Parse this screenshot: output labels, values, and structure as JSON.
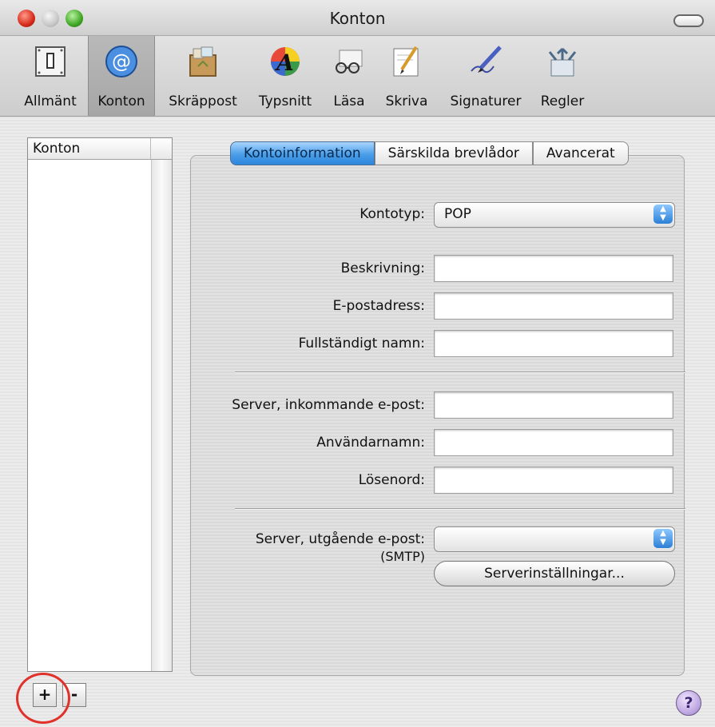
{
  "window": {
    "title": "Konton"
  },
  "toolbar": {
    "items": [
      {
        "label": "Allmänt",
        "icon": "switch-icon"
      },
      {
        "label": "Konton",
        "icon": "at-sign-icon"
      },
      {
        "label": "Skräppost",
        "icon": "junk-mail-icon"
      },
      {
        "label": "Typsnitt",
        "icon": "font-icon"
      },
      {
        "label": "Läsa",
        "icon": "glasses-icon"
      },
      {
        "label": "Skriva",
        "icon": "pencil-icon"
      },
      {
        "label": "Signaturer",
        "icon": "pen-icon"
      },
      {
        "label": "Regler",
        "icon": "rules-icon"
      }
    ]
  },
  "accounts": {
    "header": "Konton",
    "add_label": "+",
    "remove_label": "-"
  },
  "tabs": [
    "Kontoinformation",
    "Särskilda brevlådor",
    "Avancerat"
  ],
  "form": {
    "account_type_label": "Kontotyp:",
    "account_type_value": "POP",
    "description_label": "Beskrivning:",
    "email_label": "E-postadress:",
    "fullname_label": "Fullständigt namn:",
    "incoming_server_label": "Server, inkommande e-post:",
    "username_label": "Användarnamn:",
    "password_label": "Lösenord:",
    "outgoing_server_label": "Server, utgående e-post:",
    "outgoing_server_sub": "(SMTP)",
    "outgoing_server_value": "",
    "server_settings_button": "Serverinställningar..."
  },
  "help_label": "?"
}
